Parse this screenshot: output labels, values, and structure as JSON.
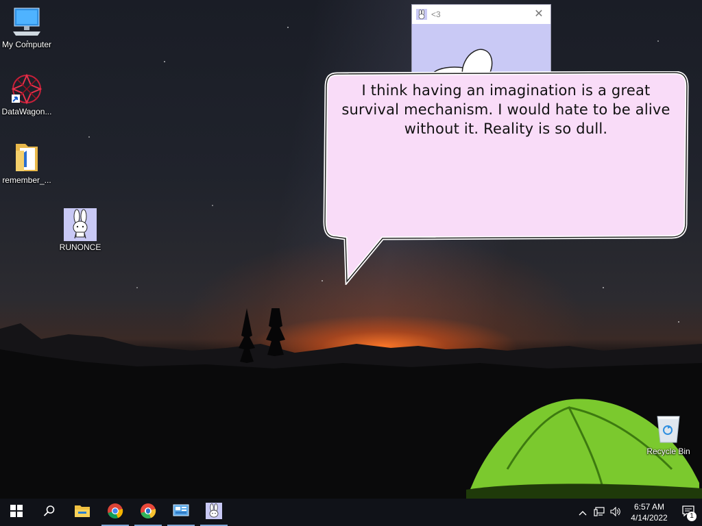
{
  "desktop": {
    "icons": [
      {
        "label": "My Computer",
        "icon": "computer-icon"
      },
      {
        "label": "DataWagon...",
        "icon": "datawagon-icon"
      },
      {
        "label": "remember_...",
        "icon": "folder-icon"
      },
      {
        "label": "RUNONCE",
        "icon": "bunny-icon"
      },
      {
        "label": "Recycle Bin",
        "icon": "recycle-bin-icon"
      }
    ]
  },
  "bunny_window": {
    "title": "<3"
  },
  "speech_bubble": {
    "text": "I think having an imagination is a great survival mechanism. I would hate to be alive without it. Reality is so dull."
  },
  "taskbar": {
    "buttons": [
      {
        "icon": "windows-start-icon"
      },
      {
        "icon": "search-icon"
      },
      {
        "icon": "file-explorer-icon"
      },
      {
        "icon": "chrome-icon"
      },
      {
        "icon": "secure-browser-icon"
      },
      {
        "icon": "control-panel-icon"
      },
      {
        "icon": "bunny-app-icon"
      }
    ],
    "clock": {
      "time": "6:57 AM",
      "date": "4/14/2022"
    },
    "notification_count": "1"
  }
}
